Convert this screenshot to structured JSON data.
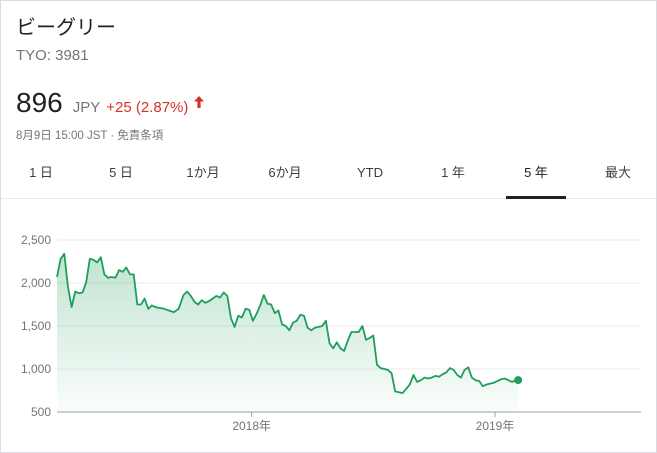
{
  "stock": {
    "company_name": "ビーグリー",
    "ticker": "TYO: 3981",
    "price": "896",
    "currency": "JPY",
    "change": "+25 (2.87%)",
    "time": "8月9日 15:00 JST",
    "disclaimer": "免責条項",
    "separator": "·",
    "change_color": "#d93025"
  },
  "tabs": [
    {
      "label": "1 日",
      "active": false
    },
    {
      "label": "5 日",
      "active": false
    },
    {
      "label": "1か月",
      "active": false
    },
    {
      "label": "6か月",
      "active": false
    },
    {
      "label": "YTD",
      "active": false
    },
    {
      "label": "1 年",
      "active": false
    },
    {
      "label": "5 年",
      "active": true
    },
    {
      "label": "最大",
      "active": false
    }
  ],
  "chart_data": {
    "type": "area",
    "line_color": "#1e9e5a",
    "y_ticks": [
      {
        "label": "2,500",
        "value": 2500
      },
      {
        "label": "2,000",
        "value": 2000
      },
      {
        "label": "1,500",
        "value": 1500
      },
      {
        "label": "1,000",
        "value": 1000
      },
      {
        "label": "500",
        "value": 500
      }
    ],
    "x_ticks": [
      {
        "label": "2018年",
        "value": 2018.0
      },
      {
        "label": "2019年",
        "value": 2019.0
      }
    ],
    "ylim": [
      500,
      2500
    ],
    "xlim": [
      2017.2,
      2019.6
    ],
    "grid": true,
    "points": [
      [
        2017.2,
        2070
      ],
      [
        2017.215,
        2280
      ],
      [
        2017.23,
        2340
      ],
      [
        2017.245,
        1960
      ],
      [
        2017.26,
        1720
      ],
      [
        2017.275,
        1900
      ],
      [
        2017.29,
        1880
      ],
      [
        2017.305,
        1890
      ],
      [
        2017.32,
        2010
      ],
      [
        2017.335,
        2280
      ],
      [
        2017.35,
        2270
      ],
      [
        2017.365,
        2240
      ],
      [
        2017.38,
        2300
      ],
      [
        2017.395,
        2100
      ],
      [
        2017.41,
        2060
      ],
      [
        2017.425,
        2070
      ],
      [
        2017.44,
        2060
      ],
      [
        2017.455,
        2150
      ],
      [
        2017.47,
        2130
      ],
      [
        2017.485,
        2180
      ],
      [
        2017.5,
        2100
      ],
      [
        2017.515,
        2100
      ],
      [
        2017.53,
        1750
      ],
      [
        2017.545,
        1750
      ],
      [
        2017.56,
        1820
      ],
      [
        2017.575,
        1700
      ],
      [
        2017.59,
        1740
      ],
      [
        2017.605,
        1720
      ],
      [
        2017.62,
        1710
      ],
      [
        2017.64,
        1700
      ],
      [
        2017.66,
        1680
      ],
      [
        2017.68,
        1660
      ],
      [
        2017.7,
        1700
      ],
      [
        2017.72,
        1860
      ],
      [
        2017.735,
        1900
      ],
      [
        2017.75,
        1850
      ],
      [
        2017.765,
        1780
      ],
      [
        2017.78,
        1750
      ],
      [
        2017.795,
        1800
      ],
      [
        2017.81,
        1770
      ],
      [
        2017.825,
        1790
      ],
      [
        2017.84,
        1820
      ],
      [
        2017.855,
        1850
      ],
      [
        2017.87,
        1830
      ],
      [
        2017.885,
        1890
      ],
      [
        2017.9,
        1850
      ],
      [
        2017.915,
        1590
      ],
      [
        2017.93,
        1490
      ],
      [
        2017.945,
        1620
      ],
      [
        2017.96,
        1600
      ],
      [
        2017.975,
        1700
      ],
      [
        2017.99,
        1690
      ],
      [
        2018.005,
        1560
      ],
      [
        2018.02,
        1640
      ],
      [
        2018.035,
        1740
      ],
      [
        2018.05,
        1860
      ],
      [
        2018.065,
        1760
      ],
      [
        2018.08,
        1750
      ],
      [
        2018.095,
        1650
      ],
      [
        2018.11,
        1680
      ],
      [
        2018.125,
        1520
      ],
      [
        2018.14,
        1500
      ],
      [
        2018.155,
        1450
      ],
      [
        2018.17,
        1540
      ],
      [
        2018.185,
        1560
      ],
      [
        2018.2,
        1630
      ],
      [
        2018.215,
        1620
      ],
      [
        2018.23,
        1480
      ],
      [
        2018.245,
        1450
      ],
      [
        2018.26,
        1480
      ],
      [
        2018.275,
        1490
      ],
      [
        2018.29,
        1500
      ],
      [
        2018.305,
        1560
      ],
      [
        2018.32,
        1300
      ],
      [
        2018.335,
        1240
      ],
      [
        2018.35,
        1310
      ],
      [
        2018.365,
        1240
      ],
      [
        2018.38,
        1210
      ],
      [
        2018.395,
        1330
      ],
      [
        2018.41,
        1430
      ],
      [
        2018.425,
        1430
      ],
      [
        2018.44,
        1430
      ],
      [
        2018.455,
        1500
      ],
      [
        2018.47,
        1340
      ],
      [
        2018.485,
        1360
      ],
      [
        2018.5,
        1390
      ],
      [
        2018.515,
        1050
      ],
      [
        2018.53,
        1010
      ],
      [
        2018.545,
        1000
      ],
      [
        2018.56,
        990
      ],
      [
        2018.575,
        950
      ],
      [
        2018.59,
        740
      ],
      [
        2018.605,
        730
      ],
      [
        2018.62,
        720
      ],
      [
        2018.635,
        770
      ],
      [
        2018.65,
        820
      ],
      [
        2018.665,
        930
      ],
      [
        2018.68,
        850
      ],
      [
        2018.695,
        870
      ],
      [
        2018.71,
        900
      ],
      [
        2018.725,
        890
      ],
      [
        2018.74,
        900
      ],
      [
        2018.755,
        920
      ],
      [
        2018.77,
        910
      ],
      [
        2018.785,
        940
      ],
      [
        2018.8,
        960
      ],
      [
        2018.815,
        1010
      ],
      [
        2018.83,
        990
      ],
      [
        2018.845,
        930
      ],
      [
        2018.86,
        900
      ],
      [
        2018.875,
        990
      ],
      [
        2018.89,
        1020
      ],
      [
        2018.905,
        900
      ],
      [
        2018.92,
        870
      ],
      [
        2018.935,
        860
      ],
      [
        2018.95,
        800
      ],
      [
        2018.965,
        820
      ],
      [
        2018.98,
        830
      ],
      [
        2018.995,
        840
      ],
      [
        2019.01,
        860
      ],
      [
        2019.025,
        880
      ],
      [
        2019.04,
        890
      ],
      [
        2019.055,
        870
      ],
      [
        2019.07,
        850
      ],
      [
        2019.085,
        865
      ],
      [
        2019.095,
        871
      ]
    ]
  }
}
